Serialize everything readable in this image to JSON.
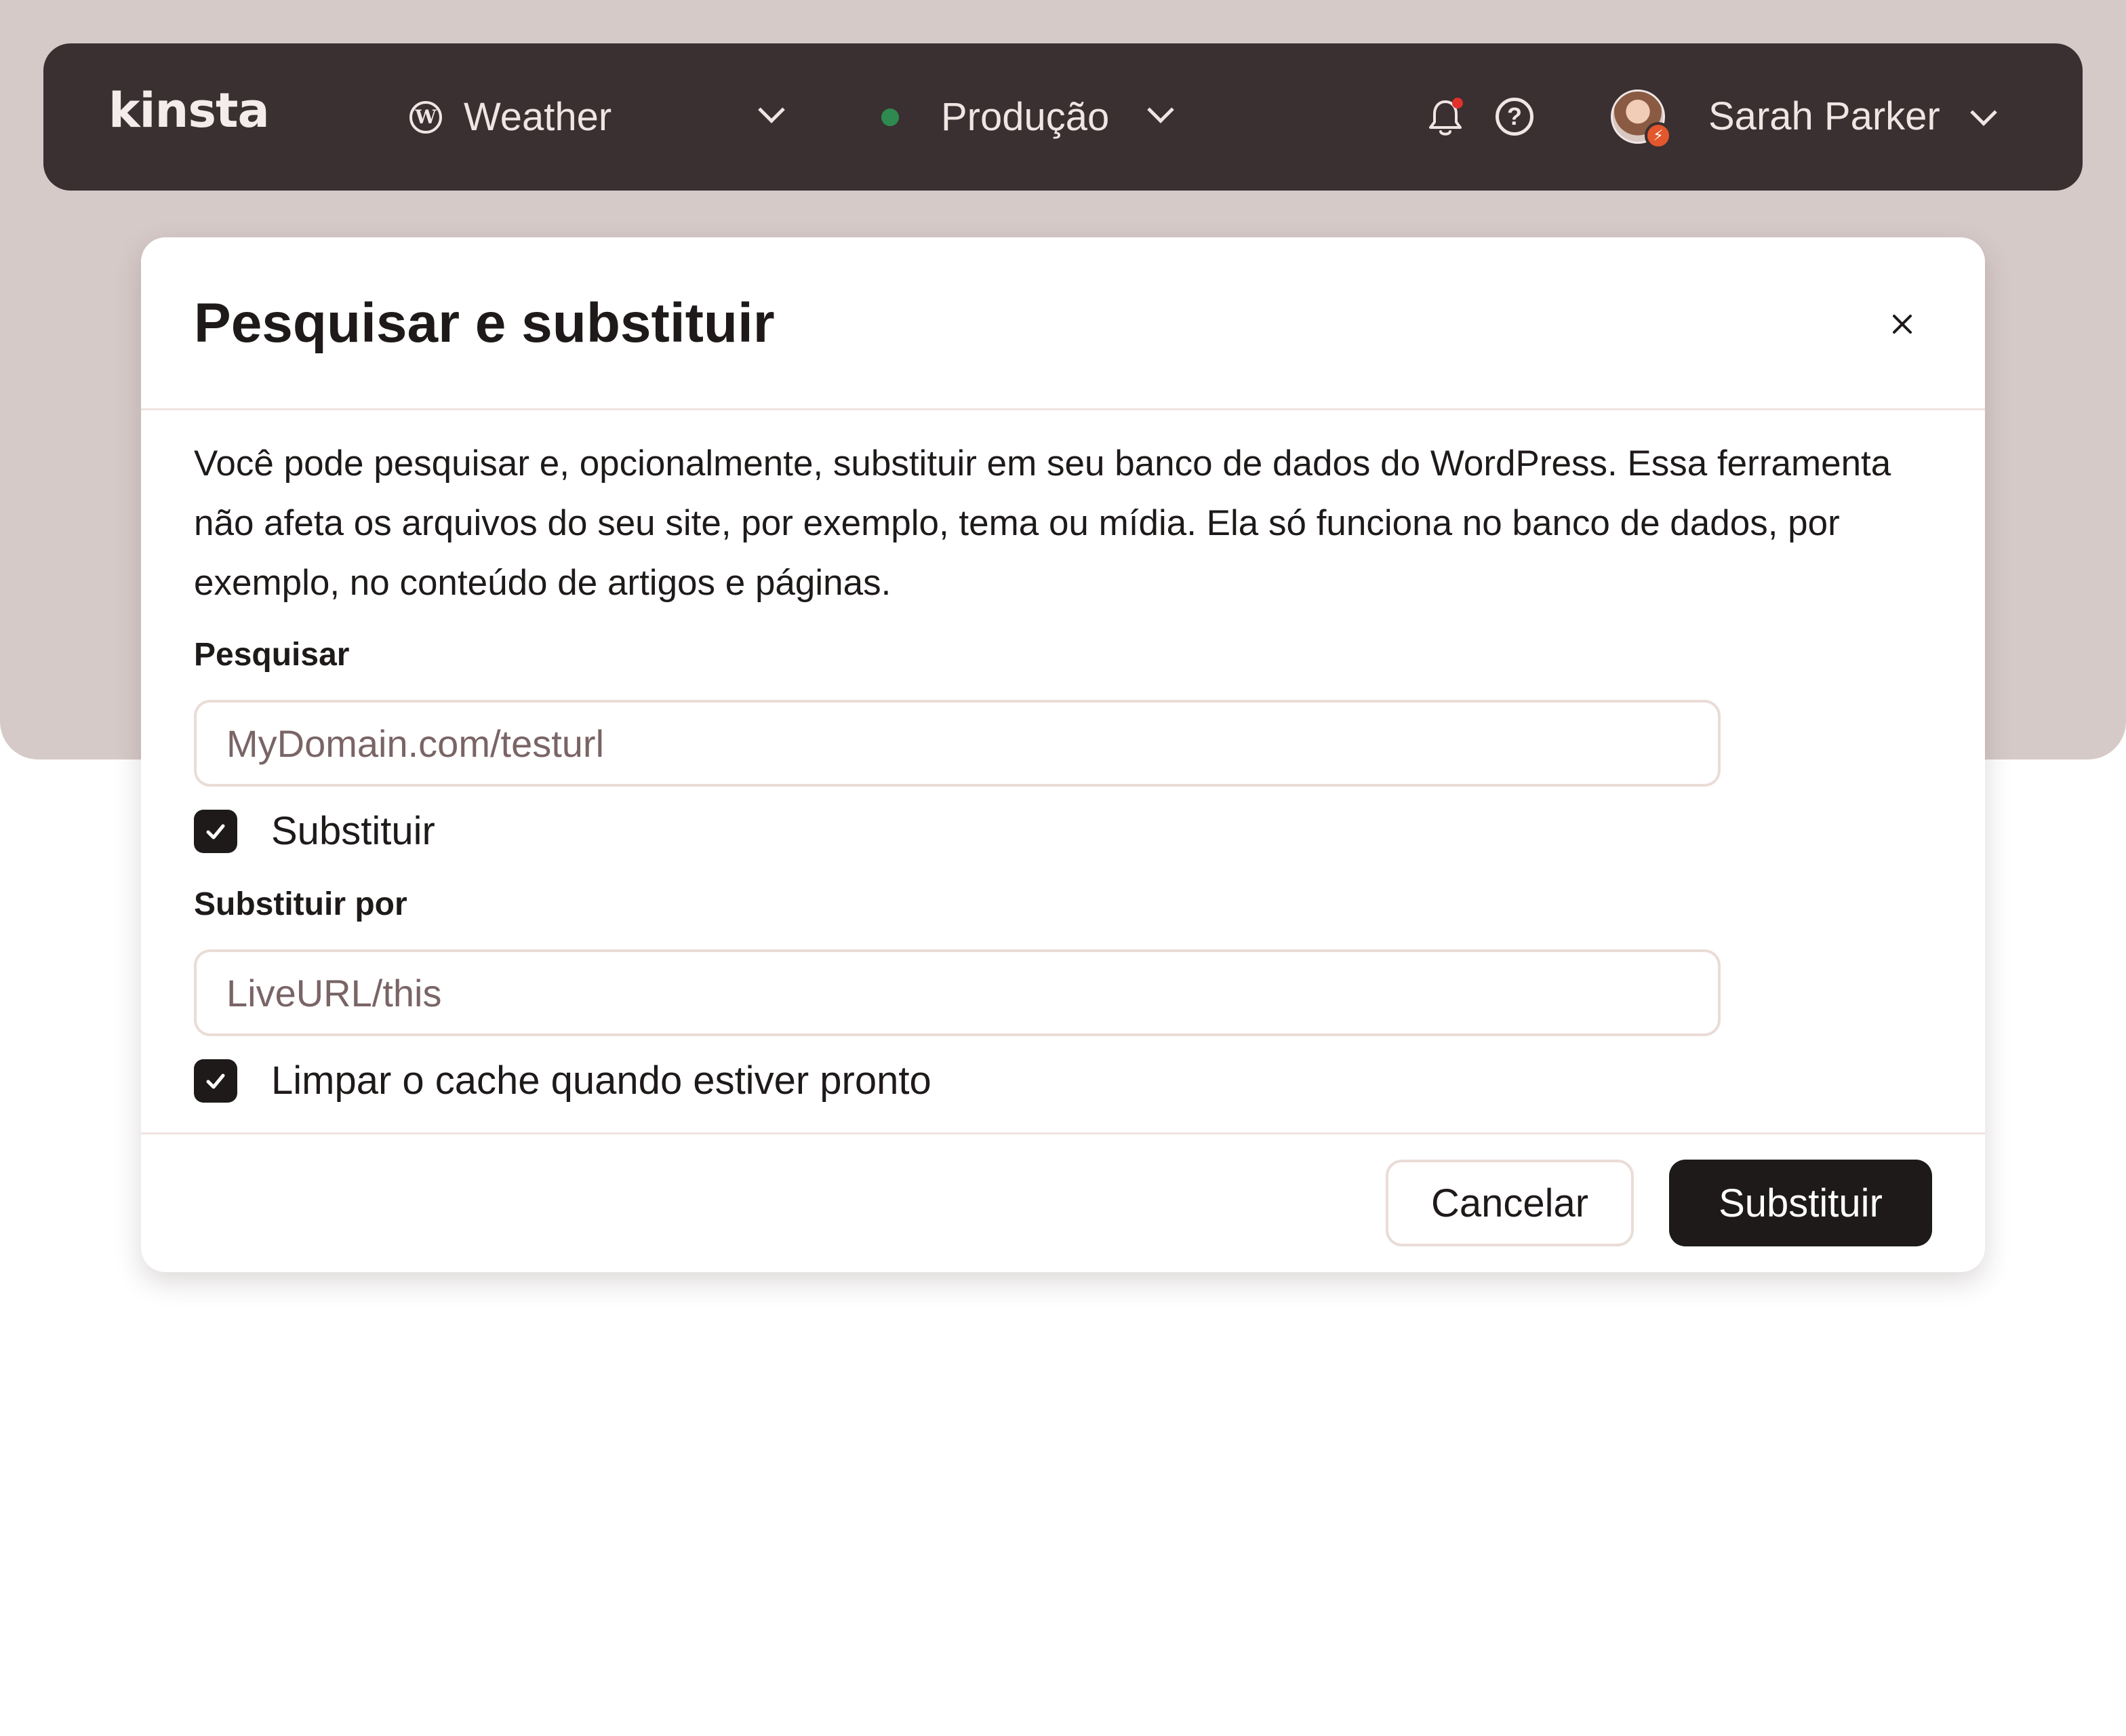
{
  "topbar": {
    "logo": "kinsta",
    "site": {
      "name": "Weather",
      "icon": "wordpress-icon"
    },
    "environment": {
      "name": "Produção",
      "status_color": "#2e8a4f"
    },
    "notifications": {
      "icon": "bell-icon",
      "has_unread": true,
      "unread_color": "#e0312a"
    },
    "help": {
      "icon": "help-icon"
    },
    "user": {
      "name": "Sarah Parker",
      "avatar_badge_icon": "bolt-icon",
      "badge_color": "#e2572c"
    }
  },
  "modal": {
    "title": "Pesquisar e substituir",
    "close_icon": "close-icon",
    "description": "Você pode pesquisar e, opcionalmente, substituir em seu banco de dados do WordPress. Essa ferramenta não afeta os arquivos do seu site, por exemplo, tema ou mídia. Ela só funciona no banco de dados, por exemplo, no conteúdo de artigos e páginas.",
    "search": {
      "label": "Pesquisar",
      "placeholder": "MyDomain.com/testurl",
      "value": ""
    },
    "replace_toggle": {
      "label": "Substituir",
      "checked": true
    },
    "replace_with": {
      "label": "Substituir por",
      "placeholder": "LiveURL/this",
      "value": ""
    },
    "clear_cache": {
      "label": "Limpar o cache quando estiver pronto",
      "checked": true
    },
    "buttons": {
      "cancel": "Cancelar",
      "submit": "Substituir"
    }
  },
  "colors": {
    "backdrop": "#d6cac9",
    "topbar": "#3a2f31",
    "primary_button": "#1f1a1a"
  }
}
